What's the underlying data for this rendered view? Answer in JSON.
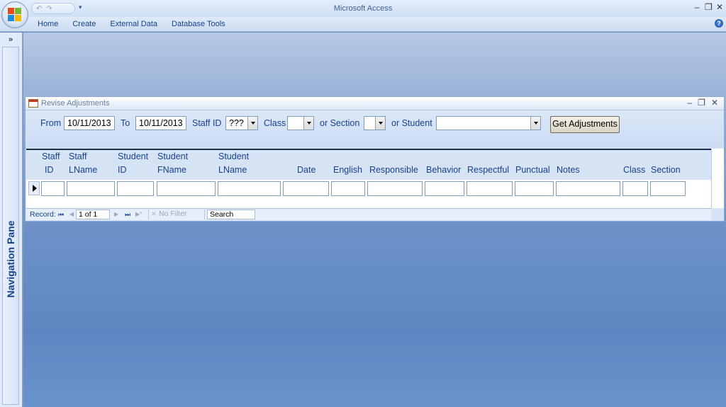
{
  "app": {
    "title": "Microsoft Access",
    "qat_undo": "↶",
    "qat_redo": "↷",
    "qat_dropdown": "▾",
    "minimize": "–",
    "restore": "❐",
    "close": "✕",
    "help": "?"
  },
  "ribbon": {
    "tabs": [
      "Home",
      "Create",
      "External Data",
      "Database Tools"
    ]
  },
  "navigation_pane": {
    "label": "Navigation Pane",
    "toggle": "»"
  },
  "form": {
    "title": "Revise Adjustments",
    "controls": {
      "minimize": "–",
      "restore": "❐",
      "close": "✕"
    },
    "filters": {
      "from_label": "From",
      "from_value": "10/11/2013",
      "to_label": "To",
      "to_value": "10/11/2013",
      "staff_id_label": "Staff ID",
      "staff_id_value": "???",
      "class_label": "Class",
      "class_value": "",
      "section_label": "or Section",
      "section_value": "",
      "student_label": "or Student",
      "student_value": "",
      "get_button": "Get Adjustments"
    },
    "columns": [
      {
        "line1": "Staff",
        "line2": "ID"
      },
      {
        "line1": "Staff",
        "line2": "LName"
      },
      {
        "line1": "Student",
        "line2": "ID"
      },
      {
        "line1": "Student",
        "line2": "FName"
      },
      {
        "line1": "Student",
        "line2": "LName"
      },
      {
        "line1": "",
        "line2": "Date"
      },
      {
        "line1": "",
        "line2": "English"
      },
      {
        "line1": "",
        "line2": "Responsible"
      },
      {
        "line1": "",
        "line2": "Behavior"
      },
      {
        "line1": "",
        "line2": "Respectful"
      },
      {
        "line1": "",
        "line2": "Punctual"
      },
      {
        "line1": "",
        "line2": "Notes"
      },
      {
        "line1": "",
        "line2": "Class"
      },
      {
        "line1": "",
        "line2": "Section"
      }
    ],
    "record_nav": {
      "label": "Record:",
      "first": "⏮",
      "prev": "◀",
      "position": "1 of 1",
      "next": "▶",
      "last": "⏭",
      "new": "▶*",
      "filter": "No Filter",
      "search": "Search"
    }
  }
}
